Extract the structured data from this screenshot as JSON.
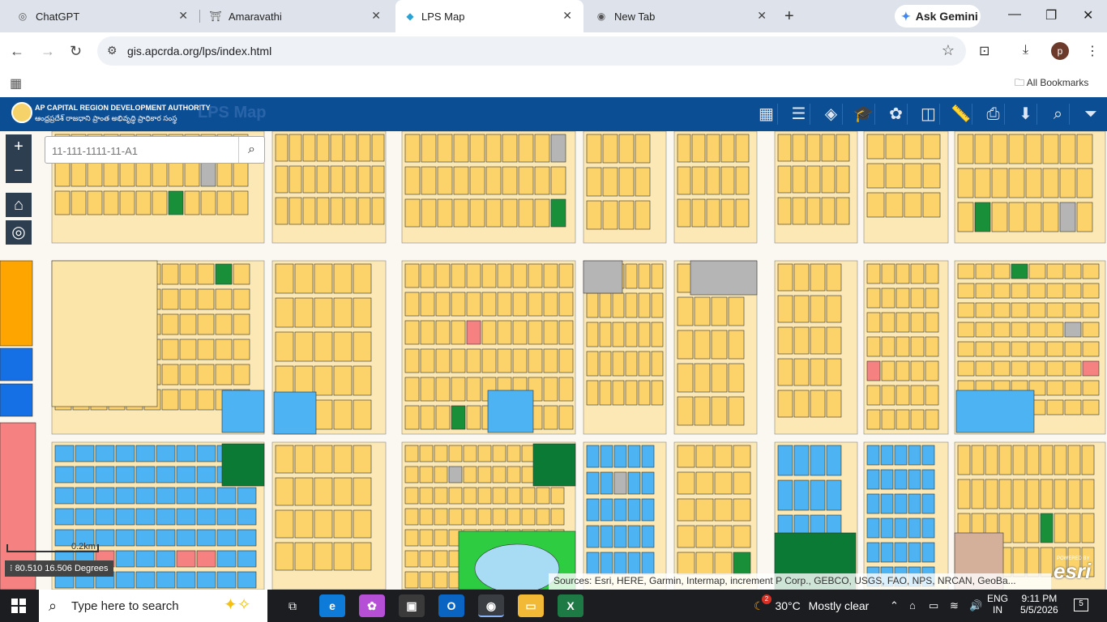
{
  "tabs": [
    {
      "title": "ChatGPT",
      "icon": "openai-icon"
    },
    {
      "title": "Amaravathi",
      "icon": "amaravathi-icon"
    },
    {
      "title": "LPS Map",
      "icon": "map-icon"
    },
    {
      "title": "New Tab",
      "icon": "chrome-icon"
    }
  ],
  "gemini": {
    "label": "Ask Gemini"
  },
  "address": {
    "url": "gis.apcrda.org/lps/index.html"
  },
  "avatar": {
    "letter": "p"
  },
  "bookmarks": {
    "all_label": "All Bookmarks"
  },
  "header": {
    "org_en": "AP CAPITAL REGION DEVELOPMENT AUTHORITY",
    "org_te": "ఆంధ్రప్రదేశ్ రాజధాని ప్రాంత అభివృద్ధి ప్రాధికార సంస్థ",
    "title": "LPS Map"
  },
  "toolbar_icons": [
    "grid-icon",
    "list-icon",
    "layers-icon",
    "education-icon",
    "palette-icon",
    "compare-icon",
    "ruler-icon",
    "print-icon",
    "download-icon",
    "query-icon",
    "filter-icon"
  ],
  "search": {
    "placeholder": "11-111-1111-11-A1"
  },
  "map": {
    "scale_label": "0.2km",
    "coordinates": "80.510 16.506 Degrees",
    "attribution": "Sources: Esri, HERE, Garmin, Intermap, increment P Corp., GEBCO, USGS, FAO, NPS, NRCAN, GeoBa...",
    "esri": "esri",
    "esri_powered": "POWERED BY"
  },
  "colors": {
    "residential": "#fcd36b",
    "commercial": "#4db3f2",
    "green": "#1a8f3a",
    "red": "#f58180",
    "gray": "#b5b5b5",
    "road": "#faf8f0",
    "park": "#2ecc40"
  },
  "taskbar": {
    "search_placeholder": "Type here to search",
    "weather_temp": "30°C",
    "weather_desc": "Mostly clear",
    "weather_badge": "2",
    "lang1": "ENG",
    "lang2": "IN",
    "time": "9:11 PM",
    "date": "5/5/2026",
    "notifications": "5"
  }
}
